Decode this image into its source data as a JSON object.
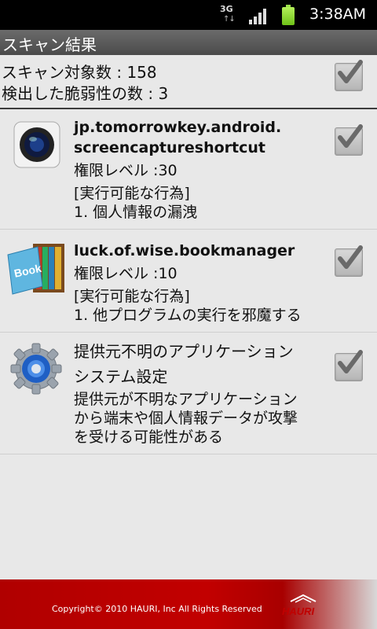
{
  "status_bar": {
    "network": "3G",
    "time": "3:38AM",
    "icons": [
      "network-3g-icon",
      "signal-icon",
      "battery-icon"
    ]
  },
  "header": {
    "title": "スキャン結果"
  },
  "summary": {
    "scan_count": "スキャン対象数 : 158",
    "vuln_count": "検出した脆弱性の数 : 3",
    "checked": true
  },
  "items": [
    {
      "name_line1": "jp.tomorrowkey.android.",
      "name_line2": "screencaptureshortcut",
      "level": "権限レベル :30",
      "action_header": "[実行可能な行為]",
      "action": "1. 個人情報の漏洩",
      "icon": "camera-lens-icon",
      "checked": true
    },
    {
      "name_line1": "luck.of.wise.bookmanager",
      "level": "権限レベル :10",
      "action_header": "[実行可能な行為]",
      "action": "1. 他プログラムの実行を邪魔する",
      "icon": "book-icon",
      "checked": true
    },
    {
      "title": "提供元不明のアプリケーション",
      "subtitle": "システム設定",
      "desc_line1": "提供元が不明なアプリケーション",
      "desc_line2": "から端末や個人情報データが攻撃",
      "desc_line3": "を受ける可能性がある",
      "icon": "settings-gear-icon",
      "checked": true
    }
  ],
  "footer": {
    "copyright": "Copyright© 2010 HAURI, Inc All Rights Reserved",
    "logo_text": "HAURI"
  },
  "colors": {
    "footer_red": "#c20000",
    "title_bar": "#555555",
    "background": "#e8e8e8"
  }
}
